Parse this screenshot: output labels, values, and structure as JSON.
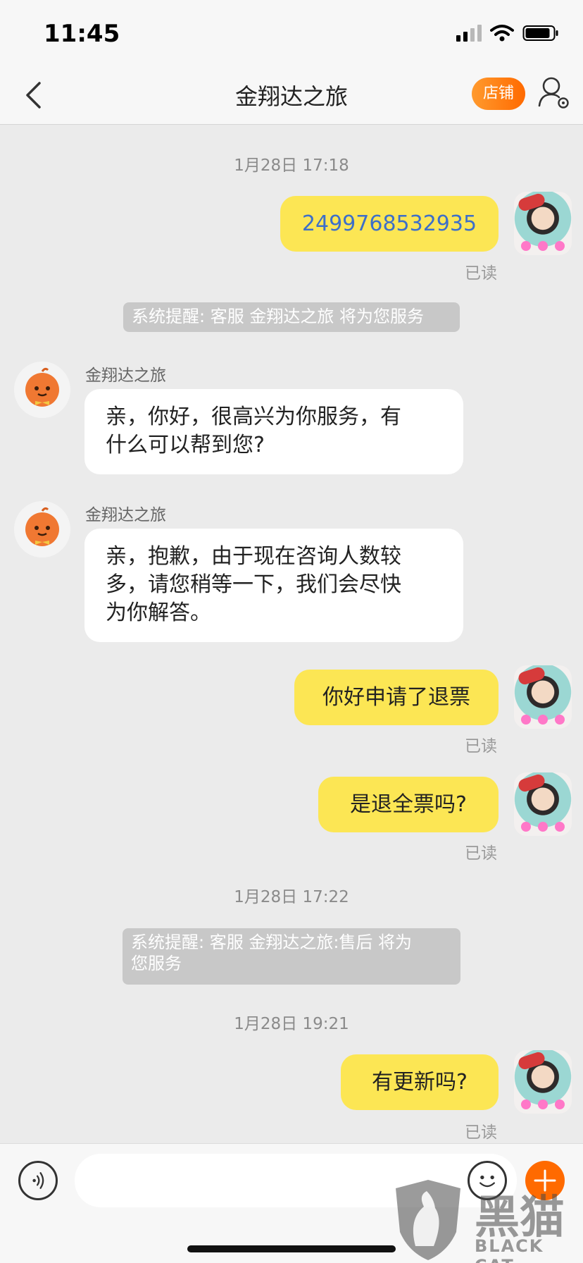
{
  "status_bar": {
    "time": "11:45"
  },
  "header": {
    "title": "金翔达之旅",
    "shop_label": "店铺"
  },
  "chat": {
    "ts1": "1月28日 17:18",
    "msg_order": "2499768532935",
    "read1": "已读",
    "notice1": "系统提醒: 客服 金翔达之旅 将为您服务",
    "agent_name1": "金翔达之旅",
    "agent_msg1_line1": "亲，你好，很高兴为你服务，有",
    "agent_msg1_line2": "什么可以帮到您?",
    "agent_name2": "金翔达之旅",
    "agent_msg2_line1": "亲，抱歉，由于现在咨询人数较",
    "agent_msg2_line2": "多，请您稍等一下，我们会尽快",
    "agent_msg2_line3": "为你解答。",
    "msg_refund": "你好申请了退票",
    "read2": "已读",
    "msg_full": "是退全票吗?",
    "read3": "已读",
    "ts2": "1月28日 17:22",
    "notice2_line1": "系统提醒: 客服 金翔达之旅:售后 将为",
    "notice2_line2": "您服务",
    "ts3": "1月28日 19:21",
    "msg_update": "有更新吗?",
    "read4": "已读"
  },
  "watermark": {
    "text": "黑猫",
    "sub": "BLACK CAT"
  },
  "colors": {
    "accent_orange": "#ff6a00",
    "my_bubble": "#fce654",
    "order_link": "#3d6fc9",
    "notice_bg": "#c8c8c8"
  }
}
